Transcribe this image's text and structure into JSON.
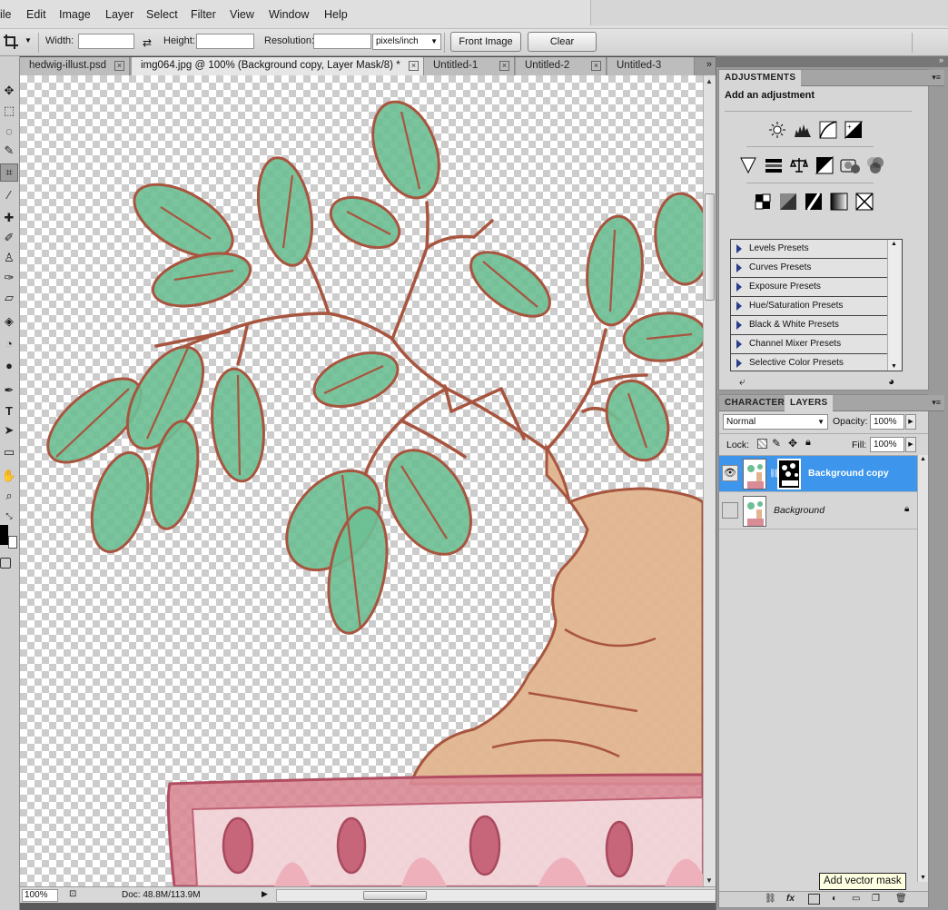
{
  "menu": [
    "ile",
    "Edit",
    "Image",
    "Layer",
    "Select",
    "Filter",
    "View",
    "Window",
    "Help"
  ],
  "options": {
    "width_label": "Width:",
    "height_label": "Height:",
    "resolution_label": "Resolution:",
    "width_value": "",
    "height_value": "",
    "resolution_value": "",
    "unit": "pixels/inch",
    "front_image": "Front Image",
    "clear": "Clear"
  },
  "tabs": [
    {
      "label": "hedwig-illust.psd",
      "active": false
    },
    {
      "label": "img064.jpg @ 100% (Background copy, Layer Mask/8) *",
      "active": true
    },
    {
      "label": "Untitled-1",
      "active": false
    },
    {
      "label": "Untitled-2",
      "active": false
    },
    {
      "label": "Untitled-3",
      "active": false
    }
  ],
  "tabs_overflow": "»",
  "status": {
    "zoom": "100%",
    "doc": "Doc: 48.8M/113.9M"
  },
  "adjustments": {
    "tab": "ADJUSTMENTS",
    "title": "Add an adjustment",
    "presets": [
      "Levels Presets",
      "Curves Presets",
      "Exposure Presets",
      "Hue/Saturation Presets",
      "Black & White Presets",
      "Channel Mixer Presets",
      "Selective Color Presets"
    ]
  },
  "layers_panel": {
    "tabs": [
      "CHARACTER",
      "LAYERS"
    ],
    "active_tab": "LAYERS",
    "blend_mode": "Normal",
    "opacity_label": "Opacity:",
    "opacity": "100%",
    "lock_label": "Lock:",
    "fill_label": "Fill:",
    "fill": "100%",
    "layers": [
      {
        "name": "Background copy",
        "selected": true,
        "visible": true
      },
      {
        "name": "Background",
        "selected": false,
        "visible": false
      }
    ]
  },
  "tooltip": "Add vector mask",
  "colors": {
    "accent": "#3d95ec",
    "leaf": "#6dbf94",
    "stem": "#a8553f",
    "pot": "#d98b96",
    "trunk": "#e2b48f"
  }
}
